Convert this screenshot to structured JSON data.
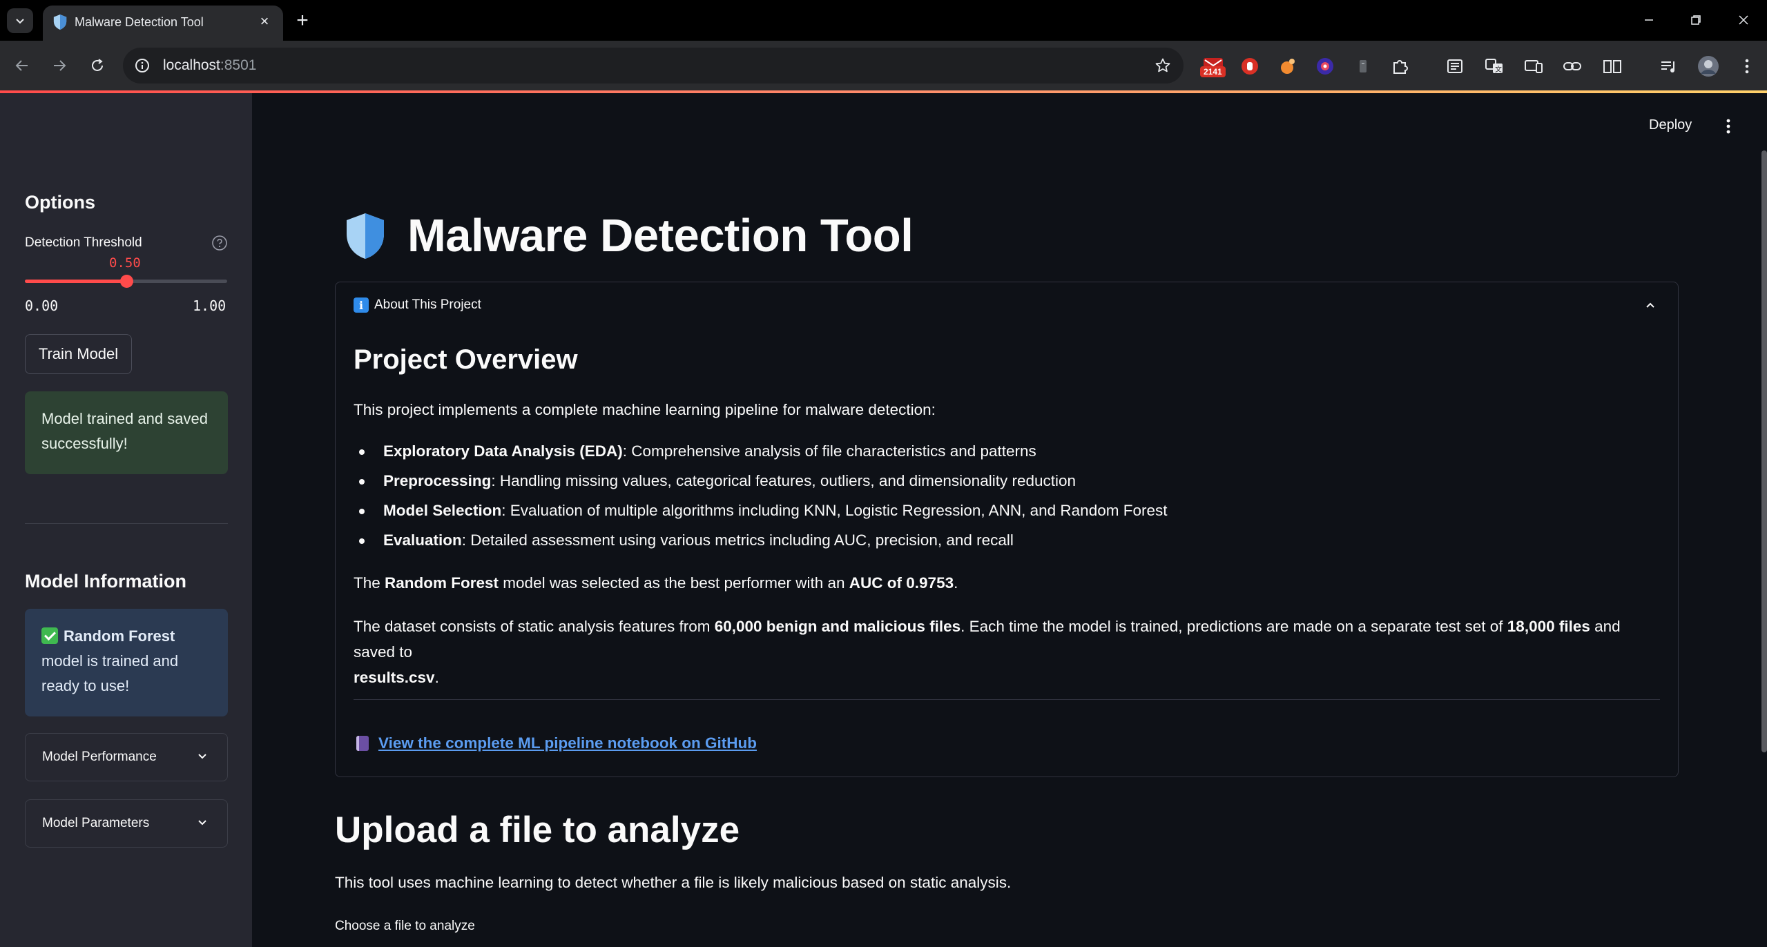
{
  "browser": {
    "tab_title": "Malware Detection Tool",
    "url_host": "localhost",
    "url_port": ":8501",
    "extension_badge": "2141"
  },
  "app": {
    "deploy_label": "Deploy",
    "title": "Malware Detection Tool"
  },
  "sidebar": {
    "options_heading": "Options",
    "threshold": {
      "label": "Detection Threshold",
      "value": "0.50",
      "value_fraction": 0.5,
      "min": "0.00",
      "max": "1.00"
    },
    "train_button": "Train Model",
    "success_message": "Model trained and saved successfully!",
    "model_info_heading": "Model Information",
    "model_status": {
      "model_name": "Random Forest",
      "text": "model is trained and ready to use!"
    },
    "expanders": [
      {
        "label": "Model Performance"
      },
      {
        "label": "Model Parameters"
      }
    ]
  },
  "about": {
    "header": "About This Project",
    "heading": "Project Overview",
    "intro": "This project implements a complete machine learning pipeline for malware detection:",
    "bullets": [
      {
        "bold": "Exploratory Data Analysis (EDA)",
        "text": ": Comprehensive analysis of file characteristics and patterns"
      },
      {
        "bold": "Preprocessing",
        "text": ": Handling missing values, categorical features, outliers, and dimensionality reduction"
      },
      {
        "bold": "Model Selection",
        "text": ": Evaluation of multiple algorithms including KNN, Logistic Regression, ANN, and Random Forest"
      },
      {
        "bold": "Evaluation",
        "text": ": Detailed assessment using various metrics including AUC, precision, and recall"
      }
    ],
    "best_model": {
      "t1": "The ",
      "b1": "Random Forest",
      "t2": " model was selected as the best performer with an ",
      "b2": "AUC of 0.9753",
      "t3": "."
    },
    "dataset": {
      "t1": "The dataset consists of static analysis features from ",
      "b1": "60,000 benign and malicious files",
      "t2": ". Each time the model is trained, predictions are made on a separate test set of ",
      "b2": "18,000 files",
      "t3": " and saved to",
      "b3": "results.csv",
      "t4": "."
    },
    "github_link": "View the complete ML pipeline notebook on GitHub"
  },
  "upload": {
    "heading": "Upload a file to analyze",
    "description": "This tool uses machine learning to detect whether a file is likely malicious based on static analysis.",
    "file_label": "Choose a file to analyze"
  },
  "colors": {
    "accent": "#ff4b4b",
    "background": "#0e1117",
    "sidebar": "#262730",
    "success_bg": "#2d4233",
    "info_bg": "#2b3a52",
    "link": "#5b9cf0"
  }
}
